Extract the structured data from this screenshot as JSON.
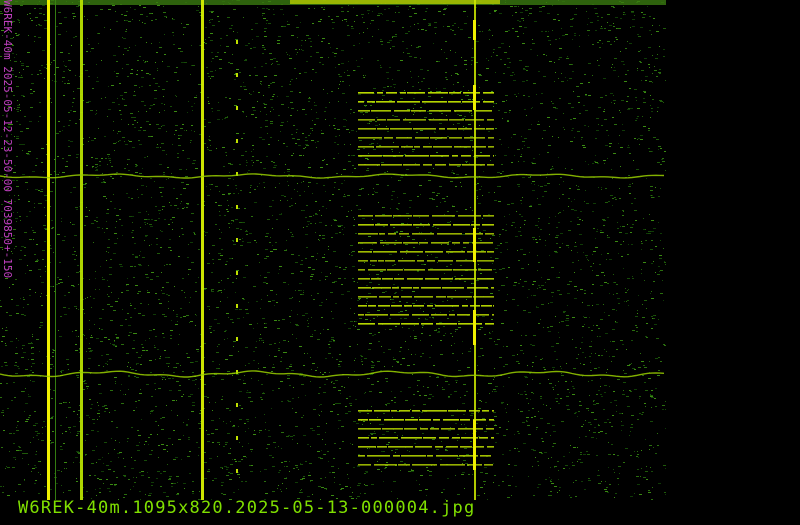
{
  "side_label": "W6REK-40m 2025-05-12-23-50-00 7039850+-150",
  "filename": "W6REK-40m.1095x820.2025-05-13-000004.jpg",
  "colors": {
    "background": "#000000",
    "side_label": "#c040c0",
    "filename": "#80e000",
    "trace_bright": "#f0f000",
    "noise": "#1f5a0a"
  }
}
